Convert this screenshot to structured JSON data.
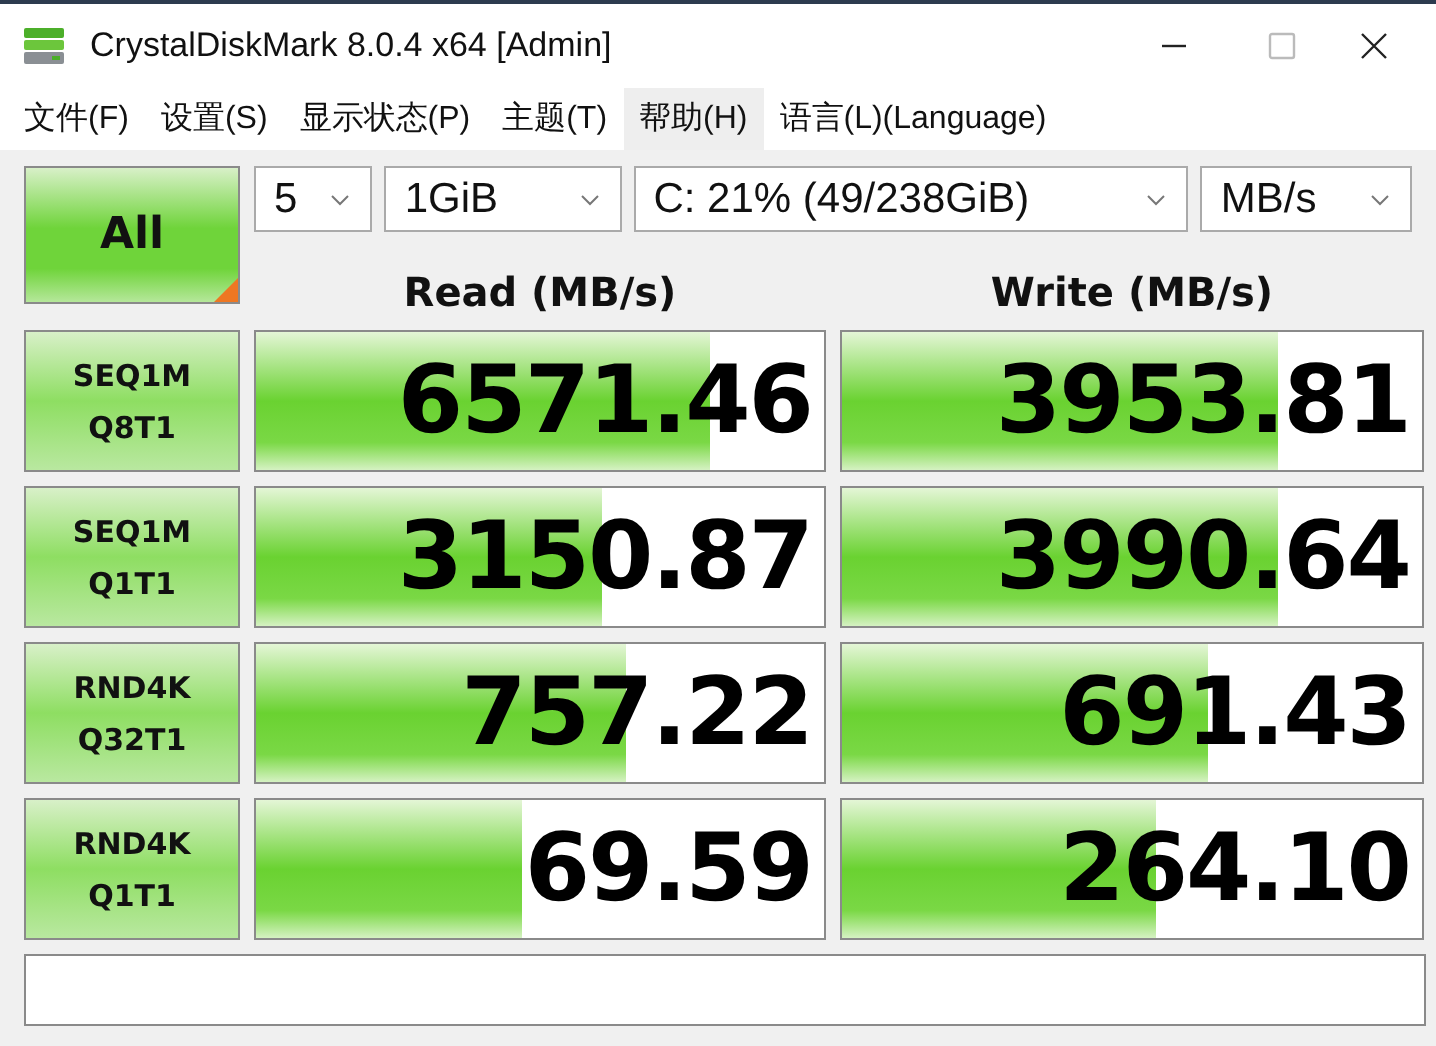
{
  "window": {
    "title": "CrystalDiskMark 8.0.4 x64 [Admin]"
  },
  "menu": [
    {
      "label": "文件(F)",
      "selected": false
    },
    {
      "label": "设置(S)",
      "selected": false
    },
    {
      "label": "显示状态(P)",
      "selected": false
    },
    {
      "label": "主题(T)",
      "selected": false
    },
    {
      "label": "帮助(H)",
      "selected": true
    },
    {
      "label": "语言(L)(Language)",
      "selected": false
    }
  ],
  "all_button": "All",
  "selectors": {
    "count": "5",
    "size": "1GiB",
    "drive": "C: 21% (49/238GiB)",
    "unit": "MB/s"
  },
  "columns": [
    "Read (MB/s)",
    "Write (MB/s)"
  ],
  "tests": [
    {
      "name": "SEQ1M",
      "params": "Q8T1",
      "read": {
        "value": "6571.46",
        "level": 0.8
      },
      "write": {
        "value": "3953.81",
        "level": 0.75
      }
    },
    {
      "name": "SEQ1M",
      "params": "Q1T1",
      "read": {
        "value": "3150.87",
        "level": 0.61
      },
      "write": {
        "value": "3990.64",
        "level": 0.75
      }
    },
    {
      "name": "RND4K",
      "params": "Q32T1",
      "read": {
        "value": "757.22",
        "level": 0.65
      },
      "write": {
        "value": "691.43",
        "level": 0.63
      }
    },
    {
      "name": "RND4K",
      "params": "Q1T1",
      "read": {
        "value": "69.59",
        "level": 0.47
      },
      "write": {
        "value": "264.10",
        "level": 0.54
      }
    }
  ]
}
